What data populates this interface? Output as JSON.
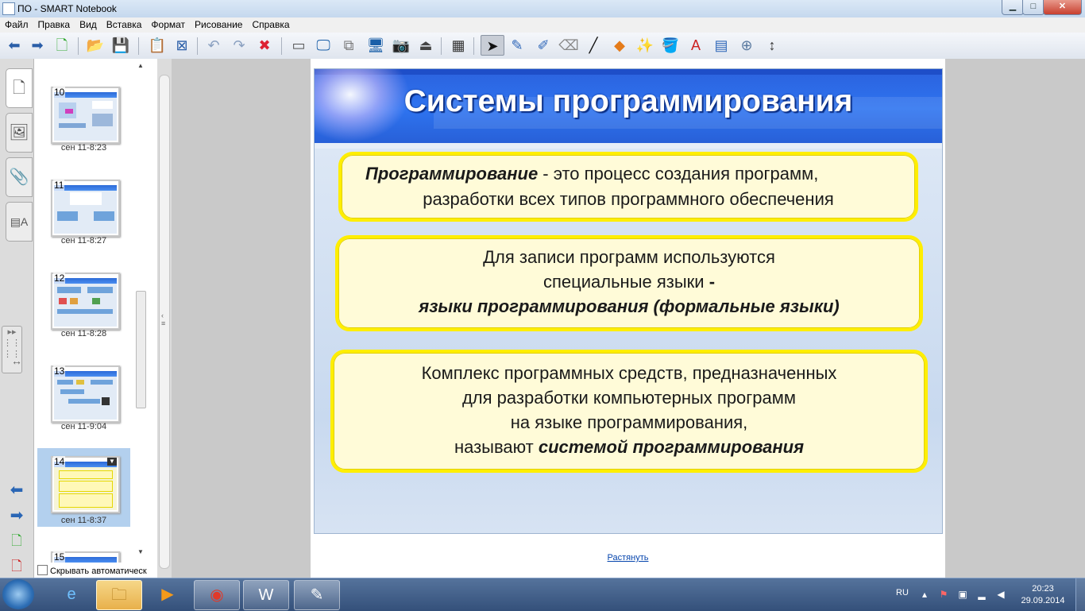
{
  "window": {
    "title": "ПО - SMART Notebook",
    "minimize_glyph": "▁",
    "maximize_glyph": "□",
    "close_glyph": "✕"
  },
  "menu": [
    "Файл",
    "Правка",
    "Вид",
    "Вставка",
    "Формат",
    "Рисование",
    "Справка"
  ],
  "toolbar": {
    "icons": [
      "back-arrow-icon",
      "forward-arrow-icon",
      "add-page-icon",
      "open-folder-icon",
      "save-icon",
      "paste-icon",
      "delete-page-icon",
      "undo-icon",
      "redo-icon",
      "delete-icon",
      "screen-shade-icon",
      "full-screen-icon",
      "transparent-background-icon",
      "dual-page-icon",
      "screen-capture-icon",
      "document-camera-icon",
      "table-icon",
      "select-icon",
      "pen-icon",
      "creative-pen-icon",
      "eraser-icon",
      "line-icon",
      "shapes-icon",
      "magic-pen-icon",
      "fill-icon",
      "text-icon",
      "properties-icon",
      "measurement-tools-icon",
      "move-toolbar-icon"
    ]
  },
  "side_tabs": [
    "page-sorter-icon",
    "gallery-icon",
    "attachments-icon",
    "properties-tab-icon"
  ],
  "page_sorter": {
    "pages": [
      {
        "number": "10",
        "caption": "сен 11-8:23"
      },
      {
        "number": "11",
        "caption": "сен 11-8:27"
      },
      {
        "number": "12",
        "caption": "сен 11-8:28"
      },
      {
        "number": "13",
        "caption": "сен 11-9:04"
      },
      {
        "number": "14",
        "caption": "сен 11-8:37",
        "selected": true
      },
      {
        "number": "15",
        "caption": ""
      }
    ],
    "autohide_label": "Скрывать автоматическ"
  },
  "slide": {
    "title": "Системы программирования",
    "box1": {
      "term": "Программирование",
      "rest": " - это процесс создания программ,",
      "line2": "разработки всех типов программного обеспечения"
    },
    "box2": {
      "line1": "Для записи программ используются",
      "line2a": "специальные языки ",
      "line2b": "-",
      "line3": "языки  программирования (формальные языки)"
    },
    "box3": {
      "line1": "Комплекс программных средств, предназначенных",
      "line2": "для разработки компьютерных программ",
      "line3": "на языке программирования,",
      "line4a": "называют ",
      "line4b": "системой программирования"
    },
    "colors": {
      "title_band": "#2e6ae6",
      "box_fill": "#fffbd8",
      "box_border": "#ffee00"
    }
  },
  "stretch_link": "Растянуть",
  "taskbar": {
    "apps": [
      "internet-explorer-icon",
      "file-explorer-icon",
      "media-player-icon",
      "chrome-icon",
      "word-icon",
      "smart-notebook-icon"
    ],
    "language": "RU",
    "time": "20:23",
    "date": "29.09.2014"
  }
}
